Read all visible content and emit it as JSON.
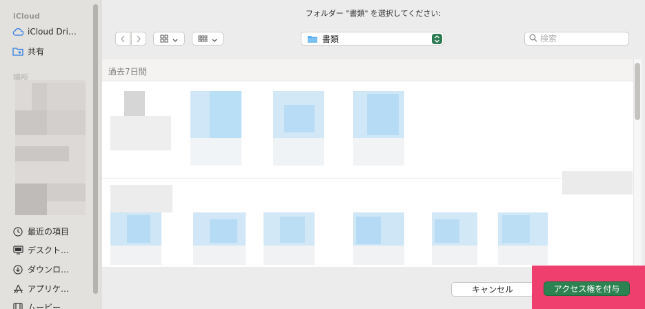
{
  "dialog_title": "フォルダー \"書類\" を選択してください:",
  "sidebar": {
    "sections": [
      {
        "label": "iCloud"
      },
      {
        "label": "場所"
      }
    ],
    "icloud_items": [
      {
        "label": "iCloud Dri…",
        "icon": "cloud-icon"
      },
      {
        "label": "共有",
        "icon": "shared-folder-icon"
      }
    ],
    "favorites": [
      {
        "label": "最近の項目",
        "icon": "clock-icon"
      },
      {
        "label": "デスクト…",
        "icon": "desktop-icon"
      },
      {
        "label": "ダウンロ…",
        "icon": "download-icon"
      },
      {
        "label": "アプリケ…",
        "icon": "applications-icon"
      },
      {
        "label": "ムービー",
        "icon": "movies-icon"
      }
    ]
  },
  "toolbar": {
    "back_icon": "chevron-left-icon",
    "forward_icon": "chevron-right-icon",
    "view_icon": "grid-icon",
    "group_icon": "group-grid-icon",
    "location": "書類",
    "search_placeholder": "検索"
  },
  "browser": {
    "section_header": "過去7日間"
  },
  "buttons": {
    "cancel": "キャンセル",
    "grant": "アクセス権を付与"
  },
  "colors": {
    "accent": "#2d8252",
    "highlight": "#ef3f6e"
  }
}
